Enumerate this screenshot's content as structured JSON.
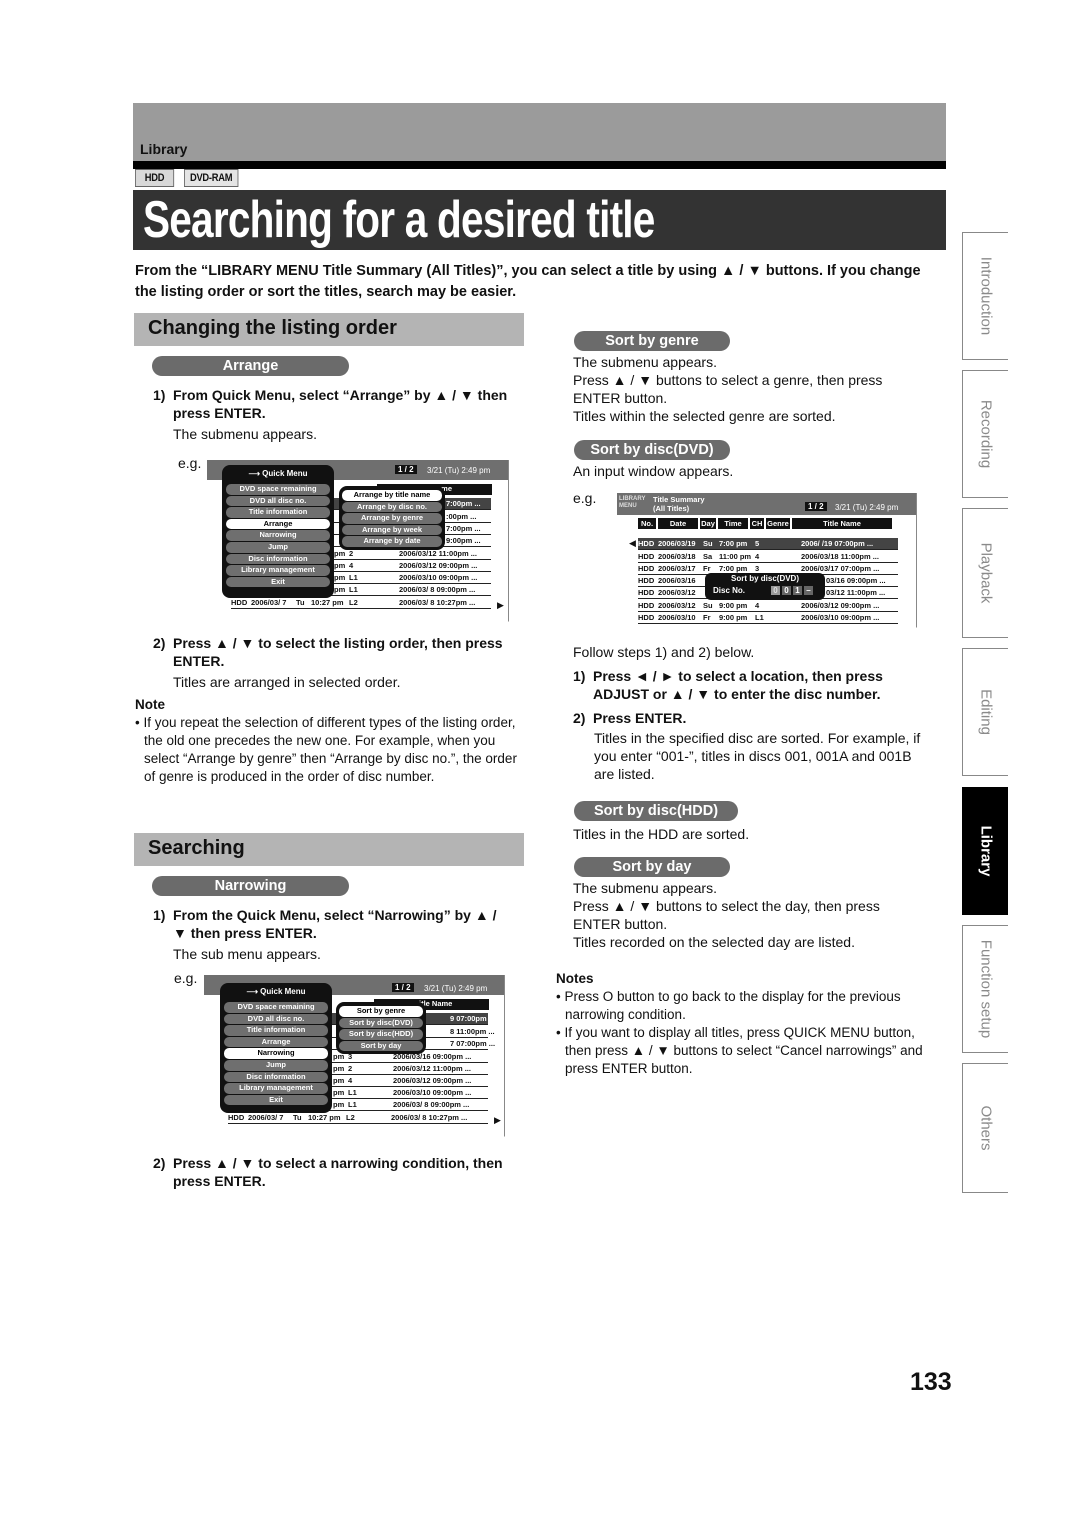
{
  "header": {
    "section_label": "Library",
    "media_badges": [
      "HDD",
      "DVD-RAM"
    ],
    "page_title": "Searching for a desired title",
    "intro": "From the “LIBRARY MENU Title Summary (All Titles)”, you can select a title by using ▲ / ▼ buttons. If you change the listing order or sort the titles, search may be easier."
  },
  "changing": {
    "heading": "Changing the listing order",
    "pill": "Arrange",
    "step1_num": "1)",
    "step1": "From Quick Menu, select “Arrange” by ▲ / ▼ then press ENTER.",
    "step1_body": "The submenu appears.",
    "eg": "e.g.",
    "step2_num": "2)",
    "step2": "Press ▲ / ▼ to select the listing order, then press ENTER.",
    "step2_body": "Titles are arranged in selected order.",
    "note_title": "Note",
    "note": "• If you repeat the selection of different types of the listing order, the old one precedes the new one. For example, when you select “Arrange by genre” then “Arrange by disc no.”, the order of genre is produced in the order of disc number."
  },
  "searching": {
    "heading": "Searching",
    "pill": "Narrowing",
    "step1_num": "1)",
    "step1": "From the Quick Menu, select “Narrowing” by ▲ / ▼ then press ENTER.",
    "step1_body": "The sub menu appears.",
    "eg": "e.g.",
    "step2_num": "2)",
    "step2": "Press ▲ / ▼ to select a narrowing condition, then press ENTER."
  },
  "right": {
    "genre_pill": "Sort by genre",
    "genre_lines": [
      "The submenu appears.",
      "Press ▲ / ▼ buttons to select a genre, then press ENTER button.",
      "Titles within the selected genre are sorted."
    ],
    "dvd_pill": "Sort by disc(DVD)",
    "dvd_line": "An input window appears.",
    "eg": "e.g.",
    "follow": "Follow steps 1) and 2) below.",
    "step1_num": "1)",
    "step1": "Press ◄ / ► to select a location, then press ADJUST or ▲ / ▼ to enter the disc number.",
    "step2_num": "2)",
    "step2": "Press ENTER.",
    "step2_body": "Titles in the specified disc are sorted. For example, if you enter “001-”, titles in discs 001, 001A and 001B are listed.",
    "hdd_pill": "Sort by disc(HDD)",
    "hdd_line": "Titles in the HDD are sorted.",
    "day_pill": "Sort by day",
    "day_lines": [
      "The submenu appears.",
      "Press ▲ / ▼ buttons to select the day, then press ENTER button.",
      "Titles recorded on the selected day are listed."
    ],
    "notes_title": "Notes",
    "notes": [
      "• Press O button to go back to the display for the previous narrowing condition.",
      "• If you want to display all titles, press QUICK MENU button, then press ▲ / ▼ buttons to select “Cancel narrowings” and press ENTER button."
    ]
  },
  "screen_common": {
    "page": "1 / 2",
    "datetime": "3/21 (Tu)  2:49 pm",
    "library_menu": "LIBRARY MENU",
    "summary": "Title Summary",
    "all_titles": "(All Titles)",
    "quick_menu_title": "Quick Menu",
    "quick_menu_items": [
      "DVD space remaining",
      "DVD all disc no.",
      "Title information",
      "Arrange",
      "Narrowing",
      "Jump",
      "Disc information",
      "Library management",
      "Exit"
    ]
  },
  "screen_arrange": {
    "highlight_index": 3,
    "submenu": [
      "Arrange by title name",
      "Arrange by disc no.",
      "Arrange by genre",
      "Arrange by week",
      "Arrange by date"
    ],
    "title_name_header": "ame",
    "partial_rows": [
      "7:00pm ...",
      ":00pm ...",
      "7:00pm ...",
      "9:00pm ..."
    ],
    "rows": [
      {
        "time": "pm",
        "ch": "2",
        "name": "2006/03/12  11:00pm ..."
      },
      {
        "time": "pm",
        "ch": "4",
        "name": "2006/03/12  09:00pm ..."
      },
      {
        "time": "pm",
        "ch": "L1",
        "name": "2006/03/10  09:00pm ..."
      },
      {
        "time": "pm",
        "ch": "L1",
        "name": "2006/03/ 8  09:00pm ..."
      },
      {
        "no": "HDD",
        "date": "2006/03/ 7",
        "day": "Tu",
        "time": "10:27 pm",
        "ch": "L2",
        "name": "2006/03/ 8  10:27pm ..."
      }
    ]
  },
  "screen_dvd": {
    "columns": [
      "No.",
      "Date",
      "Day",
      "Time",
      "CH",
      "Genre",
      "Title Name"
    ],
    "rows": [
      {
        "no": "HDD",
        "date": "2006/03/19",
        "day": "Su",
        "time": "7:00 pm",
        "ch": "5",
        "name": "2006/  /19  07:00pm ..."
      },
      {
        "no": "HDD",
        "date": "2006/03/18",
        "day": "Sa",
        "time": "11:00 pm",
        "ch": "4",
        "name": "2006/03/18  11:00pm ..."
      },
      {
        "no": "HDD",
        "date": "2006/03/17",
        "day": "Fr",
        "time": "7:00 pm",
        "ch": "3",
        "name": "2006/03/17  07:00pm ..."
      },
      {
        "no": "HDD",
        "date": "2006/03/16",
        "day": "",
        "time": "",
        "ch": "",
        "name": "03/16  09:00pm ..."
      },
      {
        "no": "HDD",
        "date": "2006/03/12",
        "day": "",
        "time": "",
        "ch": "",
        "name": "03/12  11:00pm ..."
      },
      {
        "no": "HDD",
        "date": "2006/03/12",
        "day": "Su",
        "time": "9:00 pm",
        "ch": "4",
        "name": "2006/03/12  09:00pm ..."
      },
      {
        "no": "HDD",
        "date": "2006/03/10",
        "day": "Fr",
        "time": "9:00 pm",
        "ch": "L1",
        "name": "2006/03/10  09:00pm ..."
      }
    ],
    "popup_title": "Sort by disc(DVD)",
    "popup_label": "Disc No.",
    "popup_digits": [
      "0",
      "0",
      "1",
      "–"
    ]
  },
  "screen_narrow": {
    "highlight_index": 4,
    "submenu": [
      "Sort by genre",
      "Sort by disc(DVD)",
      "Sort by disc(HDD)",
      "Sort by day"
    ],
    "title_name_header": "itle Name",
    "partial_rows": [
      "9  07:00pm ...",
      "8  11:00pm ...",
      "7  07:00pm ..."
    ],
    "rows": [
      {
        "time": "pm",
        "ch": "3",
        "name": "2006/03/16  09:00pm ..."
      },
      {
        "time": "pm",
        "ch": "2",
        "name": "2006/03/12  11:00pm ..."
      },
      {
        "time": "pm",
        "ch": "4",
        "name": "2006/03/12  09:00pm ..."
      },
      {
        "time": "pm",
        "ch": "L1",
        "name": "2006/03/10  09:00pm ..."
      },
      {
        "time": "pm",
        "ch": "L1",
        "name": "2006/03/ 8  09:00pm ..."
      },
      {
        "no": "HDD",
        "date": "2006/03/ 7",
        "day": "Tu",
        "time": "10:27 pm",
        "ch": "L2",
        "name": "2006/03/ 8  10:27pm ..."
      }
    ]
  },
  "side_tabs": [
    {
      "label": "Introduction",
      "active": false
    },
    {
      "label": "Recording",
      "active": false
    },
    {
      "label": "Playback",
      "active": false
    },
    {
      "label": "Editing",
      "active": false
    },
    {
      "label": "Library",
      "active": true
    },
    {
      "label": "Function setup",
      "active": false
    },
    {
      "label": "Others",
      "active": false
    }
  ],
  "page_number": "133"
}
